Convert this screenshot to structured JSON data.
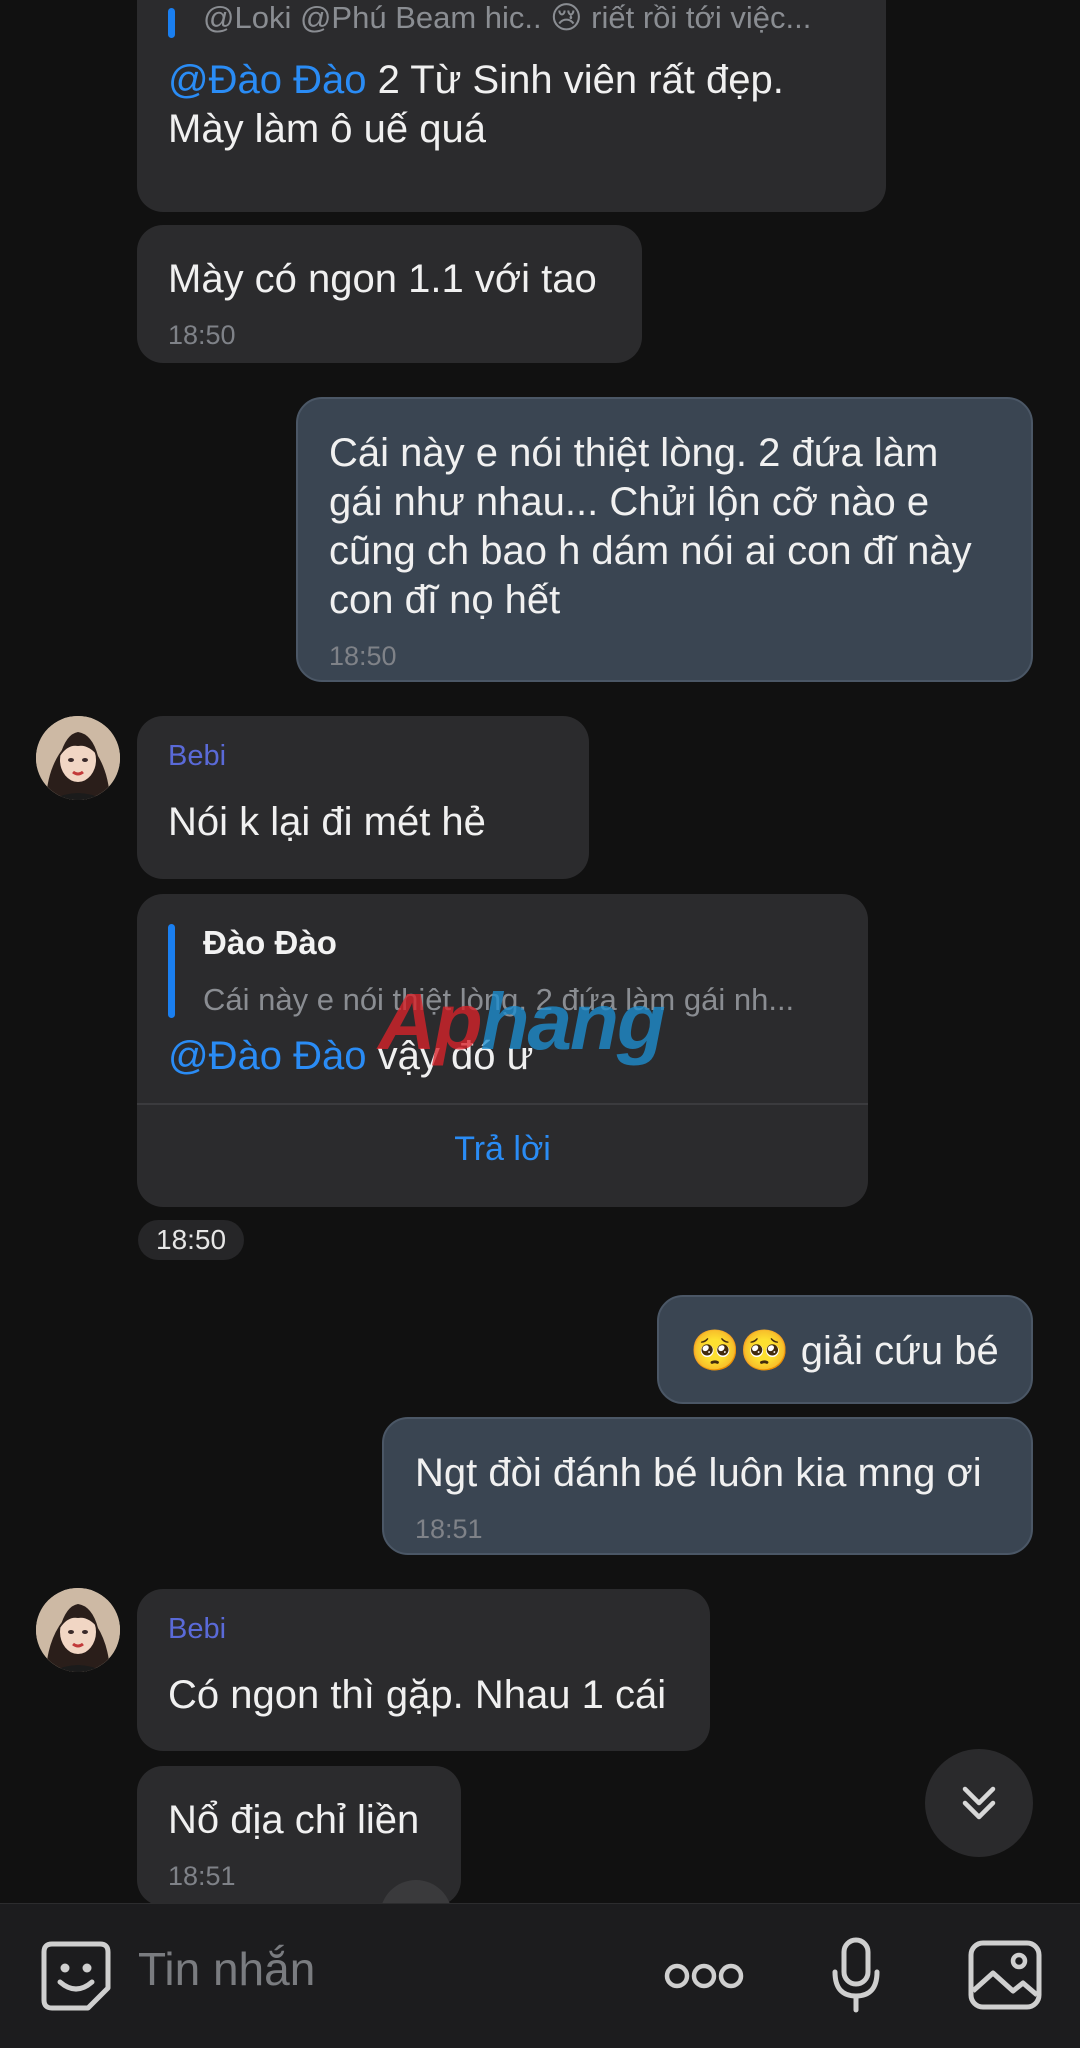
{
  "messages": {
    "m1": {
      "quote_text": "@Loki @Phú Beam hic.. 😢 riết rồi tới việc...",
      "mention": "@Đào Đào",
      "line1_rest": " 2 Từ Sinh viên rất đẹp.",
      "line2": "Mày làm ô uế quá"
    },
    "m2": {
      "text": "Mày có ngon 1.1 với tao",
      "time": "18:50"
    },
    "m3": {
      "lines": [
        "Cái này e nói thiệt lòng. 2 đứa làm",
        "gái như nhau... Chửi lộn cỡ nào e",
        "cũng ch bao h dám nói ai con đĩ này",
        "con đĩ nọ hết"
      ],
      "time": "18:50"
    },
    "m4": {
      "sender": "Bebi",
      "text": "Nói k lại đi mét hẻ"
    },
    "m5": {
      "quote_title": "Đào Đào",
      "quote_text": "Cái này e nói thiệt lòng. 2 đứa làm gái nh...",
      "mention": "@Đào Đào",
      "rest": " vậy đó ư",
      "reply_label": "Trả lời",
      "time": "18:50"
    },
    "m6": {
      "emoji": "🥺🥺",
      "text": " giải cứu bé"
    },
    "m7": {
      "text": "Ngt đòi đánh bé luôn kia mng ơi",
      "time": "18:51"
    },
    "m8": {
      "sender": "Bebi",
      "text": "Có ngon thì gặp. Nhau 1 cái"
    },
    "m9": {
      "text": "Nổ địa chỉ liền",
      "time": "18:51"
    }
  },
  "watermark": {
    "part1": "Ap",
    "part2": "hang"
  },
  "composer": {
    "placeholder": "Tin nhắn"
  },
  "icons": {
    "sticker": "sticker-icon",
    "more": "more-options-icon",
    "mic": "microphone-icon",
    "image": "image-icon",
    "scroll": "scroll-to-bottom-icon"
  },
  "colors": {
    "background": "#111111",
    "incoming_bubble": "#2b2b2d",
    "outgoing_bubble": "#3a4552",
    "mention": "#2a8cf5",
    "sender": "#5a6ad8"
  }
}
